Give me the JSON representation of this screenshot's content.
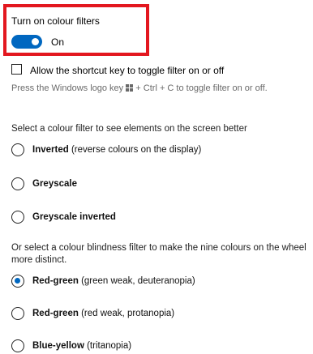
{
  "toggle": {
    "label": "Turn on colour filters",
    "state": "On",
    "on": true,
    "accent_color": "#0067c0",
    "highlight_color": "#e3171f"
  },
  "shortcut": {
    "checkbox_label": "Allow the shortcut key to toggle filter on or off",
    "checked": false,
    "hint_before": "Press the Windows logo key",
    "hint_after": "+ Ctrl + C to toggle filter on or off."
  },
  "filters": {
    "heading": "Select a colour filter to see elements on the screen better",
    "options": [
      {
        "name": "Inverted",
        "desc": " (reverse colours on the display)",
        "selected": false
      },
      {
        "name": "Greyscale",
        "desc": "",
        "selected": false
      },
      {
        "name": "Greyscale inverted",
        "desc": "",
        "selected": false
      }
    ]
  },
  "blindness": {
    "heading": "Or select a colour blindness filter to make the nine colours on the wheel more distinct.",
    "options": [
      {
        "name": "Red-green",
        "desc": " (green weak, deuteranopia)",
        "selected": true
      },
      {
        "name": "Red-green",
        "desc": " (red weak, protanopia)",
        "selected": false
      },
      {
        "name": "Blue-yellow",
        "desc": " (tritanopia)",
        "selected": false
      }
    ]
  }
}
